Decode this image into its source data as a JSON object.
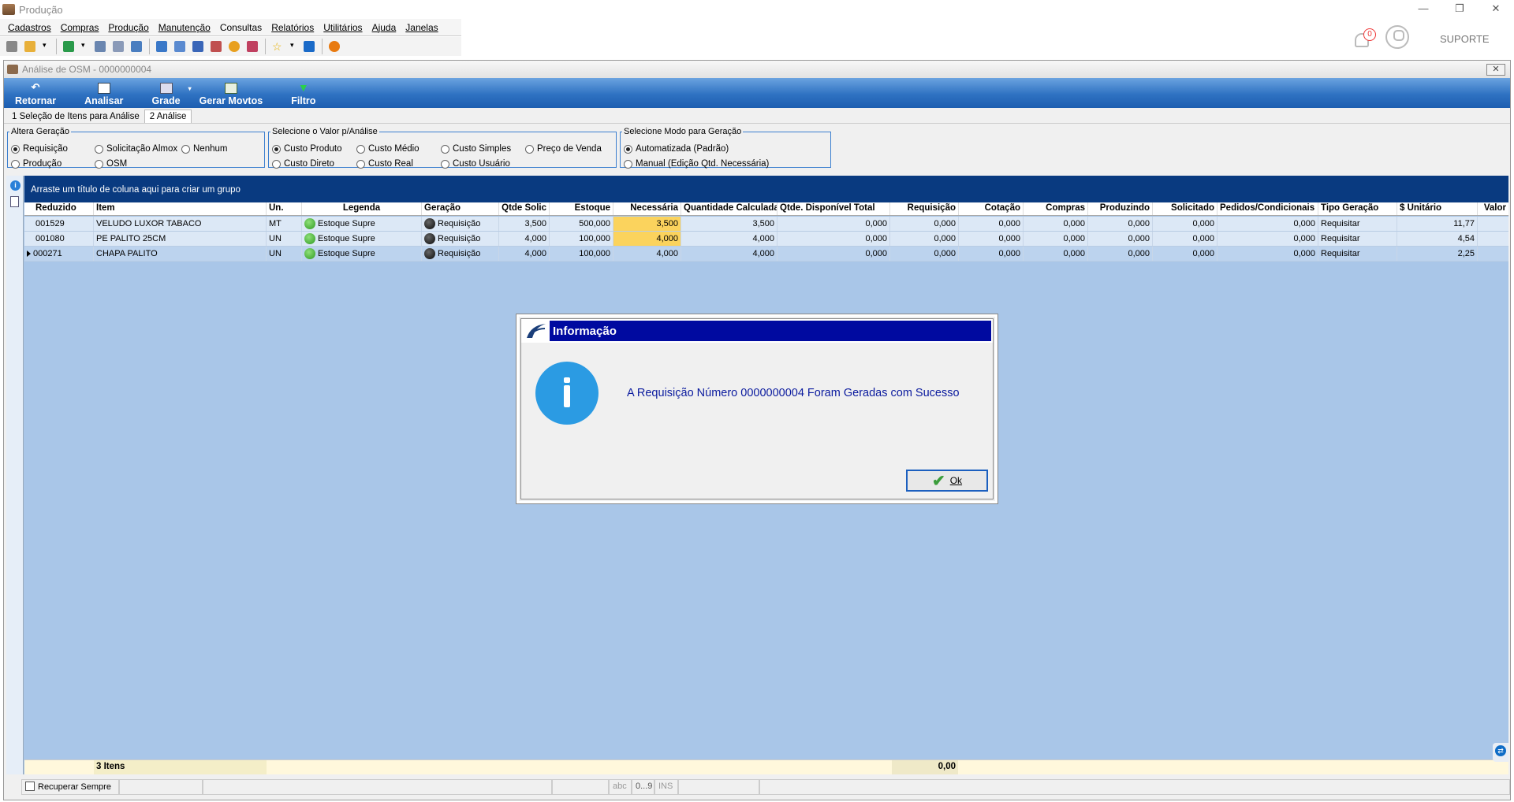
{
  "window": {
    "title": "Produção",
    "controls": [
      "—",
      "❐",
      "✕"
    ]
  },
  "menu": [
    "Cadastros",
    "Compras",
    "Produção",
    "Manutenção",
    "Consultas",
    "Relatórios",
    "Utilitários",
    "Ajuda",
    "Janelas"
  ],
  "header": {
    "notification_count": "0",
    "username": "SUPORTE"
  },
  "mdi": {
    "title": "Análise de OSM - 0000000004",
    "close": "✕"
  },
  "ribbon": {
    "retornar": "Retornar",
    "analisar": "Analisar",
    "grade": "Grade",
    "gerar_movtos": "Gerar Movtos",
    "filtro": "Filtro"
  },
  "tabs": {
    "tab1": "1 Seleção de Itens para Análise",
    "tab2": "2 Análise"
  },
  "options": {
    "altera_geracao": {
      "legend": "Altera Geração",
      "requisicao": "Requisição",
      "solicitacao": "Solicitação Almox",
      "nenhum": "Nenhum",
      "producao": "Produção",
      "osm": "OSM"
    },
    "valor": {
      "legend": "Selecione o Valor p/Análise",
      "custo_produto": "Custo Produto",
      "custo_medio": "Custo Médio",
      "custo_simples": "Custo Simples",
      "preco_venda": "Preço de Venda",
      "custo_direto": "Custo Direto",
      "custo_real": "Custo Real",
      "custo_usuario": "Custo Usuário"
    },
    "modo": {
      "legend": "Selecione Modo para Geração",
      "automatizada": "Automatizada (Padrão)",
      "manual": "Manual (Edição Qtd. Necessária)"
    }
  },
  "grid": {
    "group_hint": "Arraste um título de coluna aqui para criar um grupo",
    "columns": [
      "Reduzido",
      "Item",
      "Un.",
      "Legenda",
      "Geração",
      "Qtde Solic",
      "Estoque",
      "Necessária",
      "Quantidade Calculada",
      "Qtde. Disponível Total",
      "Requisição",
      "Cotação",
      "Compras",
      "Produzindo",
      "Solicitado",
      "Pedidos/Condicionais",
      "Tipo Geração",
      "$ Unitário",
      "Valor"
    ],
    "rows": [
      {
        "reduzido": "001529",
        "item": "VELUDO LUXOR TABACO",
        "un": "MT",
        "legenda": "Estoque Supre",
        "geracao": "Requisição",
        "qtde_solic": "3,500",
        "estoque": "500,000",
        "necessaria": "3,500",
        "qtd_calc": "3,500",
        "disp": "0,000",
        "requisicao": "0,000",
        "cotacao": "0,000",
        "compras": "0,000",
        "produzindo": "0,000",
        "solicitado": "0,000",
        "pedidos": "0,000",
        "tipo": "Requisitar",
        "unitario": "11,77"
      },
      {
        "reduzido": "001080",
        "item": "PE PALITO 25CM",
        "un": "UN",
        "legenda": "Estoque Supre",
        "geracao": "Requisição",
        "qtde_solic": "4,000",
        "estoque": "100,000",
        "necessaria": "4,000",
        "qtd_calc": "4,000",
        "disp": "0,000",
        "requisicao": "0,000",
        "cotacao": "0,000",
        "compras": "0,000",
        "produzindo": "0,000",
        "solicitado": "0,000",
        "pedidos": "0,000",
        "tipo": "Requisitar",
        "unitario": "4,54"
      },
      {
        "reduzido": "000271",
        "item": "CHAPA PALITO",
        "un": "UN",
        "legenda": "Estoque Supre",
        "geracao": "Requisição",
        "qtde_solic": "4,000",
        "estoque": "100,000",
        "necessaria": "4,000",
        "qtd_calc": "4,000",
        "disp": "0,000",
        "requisicao": "0,000",
        "cotacao": "0,000",
        "compras": "0,000",
        "produzindo": "0,000",
        "solicitado": "0,000",
        "pedidos": "0,000",
        "tipo": "Requisitar",
        "unitario": "2,25"
      }
    ],
    "footer_count": "3 Itens",
    "footer_total": "0,00"
  },
  "statusbar": {
    "recuperar": "Recuperar Sempre",
    "abc": "abc",
    "num": "0...9",
    "ins": "INS"
  },
  "dialog": {
    "title": "Informação",
    "message": "A Requisição Número 0000000004 Foram Geradas com Sucesso",
    "ok": "Ok"
  },
  "colors": {
    "ribbon": "#2f72c2",
    "group_panel": "#093a80",
    "dialog_title": "#000aa0",
    "highlight": "#fbd35d",
    "grid_bg": "#a9c6e8"
  }
}
